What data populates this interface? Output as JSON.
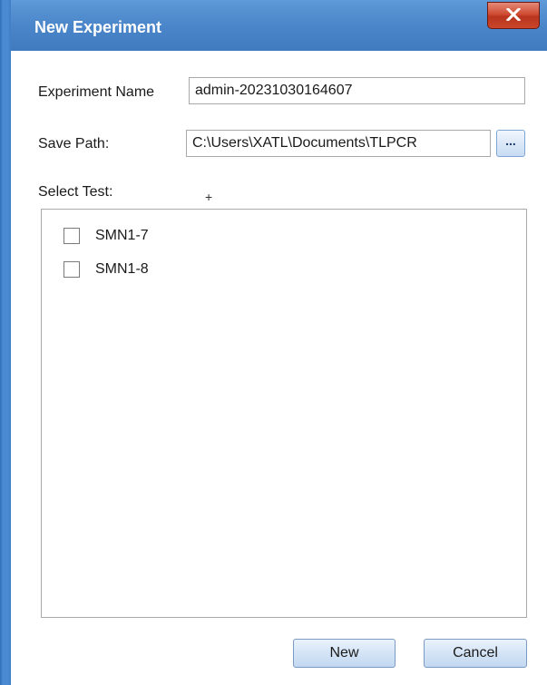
{
  "dialog": {
    "title": "New Experiment",
    "close_icon": "close-x-icon"
  },
  "form": {
    "experiment_name_label": "Experiment Name",
    "experiment_name_value": "admin-20231030164607",
    "save_path_label": "Save Path:",
    "save_path_value": "C:\\Users\\XATL\\Documents\\TLPCR",
    "browse_label": "...",
    "select_test_label": "Select Test:"
  },
  "tests": [
    {
      "label": "SMN1-7",
      "checked": false
    },
    {
      "label": "SMN1-8",
      "checked": false
    }
  ],
  "buttons": {
    "new_label": "New",
    "cancel_label": "Cancel"
  },
  "colors": {
    "title_bar": "#4a86c9",
    "close_button": "#cf4c32",
    "button_face": "#d4e4f6"
  }
}
